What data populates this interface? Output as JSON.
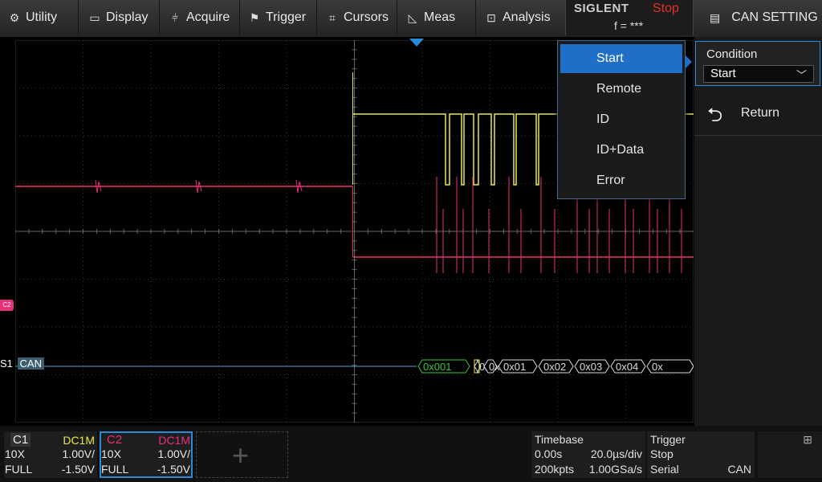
{
  "menu": {
    "items": [
      {
        "id": "utility",
        "label": "Utility",
        "icon": "gear-icon",
        "glyph": "⚙"
      },
      {
        "id": "display",
        "label": "Display",
        "icon": "display-icon",
        "glyph": "▭"
      },
      {
        "id": "acquire",
        "label": "Acquire",
        "icon": "acquire-icon",
        "glyph": "⫩"
      },
      {
        "id": "trigger",
        "label": "Trigger",
        "icon": "trigger-flag-icon",
        "glyph": "⚑"
      },
      {
        "id": "cursors",
        "label": "Cursors",
        "icon": "cursors-icon",
        "glyph": "⌗"
      },
      {
        "id": "meas",
        "label": "Meas",
        "icon": "measure-icon",
        "glyph": "◺"
      },
      {
        "id": "analysis",
        "label": "Analysis",
        "icon": "analysis-icon",
        "glyph": "⊡"
      }
    ],
    "brand": "SIGLENT",
    "run_state": "Stop",
    "frequency": "f = ***",
    "title": "CAN SETTING",
    "title_icon": "document-icon"
  },
  "dropdown": {
    "options": [
      "Start",
      "Remote",
      "ID",
      "ID+Data",
      "Error"
    ],
    "selected": "Start"
  },
  "panel": {
    "condition_label": "Condition",
    "condition_value": "Start",
    "return_label": "Return"
  },
  "channel_markers": {
    "c2": "C2",
    "s1_label": "S1",
    "s1_protocol": "CAN"
  },
  "decode_frames": [
    "0x001",
    "0x",
    "0x00",
    "0x01",
    "0x02",
    "0x03",
    "0x04",
    "0x"
  ],
  "channels": [
    {
      "name": "C1",
      "coupling": "DC1M",
      "probe": "10X",
      "scale": "1.00V/",
      "bandwidth": "FULL",
      "offset": "-1.50V",
      "color": "#e8e84a"
    },
    {
      "name": "C2",
      "coupling": "DC1M",
      "probe": "10X",
      "scale": "1.00V/",
      "bandwidth": "FULL",
      "offset": "-1.50V",
      "color": "#e8307a"
    }
  ],
  "timebase": {
    "title": "Timebase",
    "delay": "0.00s",
    "scale": "20.0µs/div",
    "memory": "200kpts",
    "sample_rate": "1.00GSa/s"
  },
  "trigger": {
    "title": "Trigger",
    "mode": "Stop",
    "type": "Serial",
    "source": "CAN"
  },
  "colors": {
    "ch1": "#e8e84a",
    "ch2": "#e8307a",
    "serial": "#5aa0d8",
    "accent": "#1f6fc8",
    "stop": "#e2302a",
    "decode_start": "#3cc83c"
  },
  "icons": {
    "network": "network-icon",
    "add_channel": "add-channel-icon",
    "return": "return-arrow-icon"
  }
}
